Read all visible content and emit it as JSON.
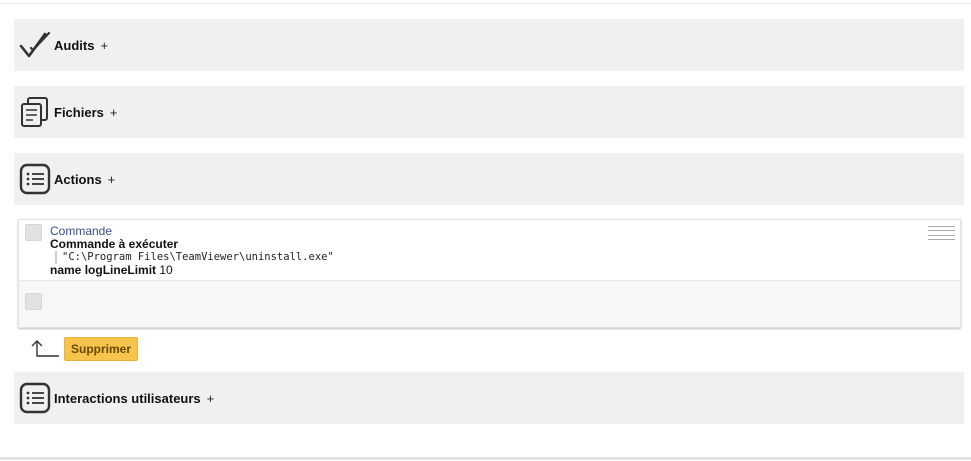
{
  "sections": {
    "audits": {
      "title": "Audits",
      "toggle": "+"
    },
    "files": {
      "title": "Fichiers",
      "toggle": "+"
    },
    "actions": {
      "title": "Actions",
      "toggle": "+"
    },
    "interactions": {
      "title": "Interactions utilisateurs",
      "toggle": "+"
    }
  },
  "action_item": {
    "type": "Commande",
    "label": "Commande à exécuter",
    "value": "\"C:\\Program Files\\TeamViewer\\uninstall.exe\"",
    "param_prefix": "name",
    "param_name": "logLineLimit",
    "param_value": "10"
  },
  "controls": {
    "delete_label": "Supprimer"
  },
  "icons": {
    "audits": "double-check-icon",
    "files": "files-icon",
    "actions": "list-icon",
    "interactions": "list-icon",
    "move": "arrow-up-icon",
    "drag": "drag-handle-icon"
  },
  "colors": {
    "section_bg": "#f0f0f0",
    "button_bg": "#f6c44c",
    "type_text": "#3a4f8a"
  }
}
